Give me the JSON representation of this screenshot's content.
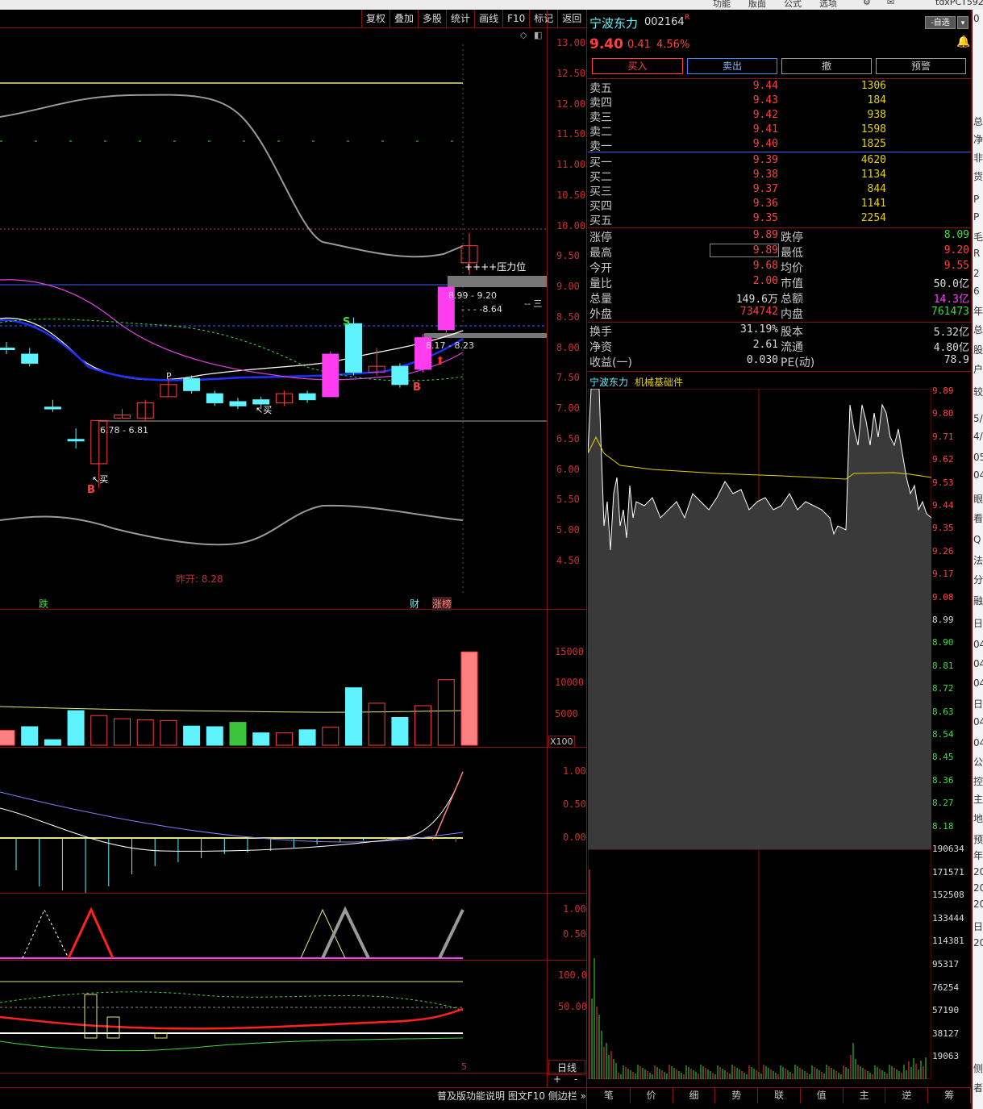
{
  "topbar": {
    "items": [
      "功能",
      "版面",
      "公式",
      "选项"
    ],
    "window_title": "tdxPCT592"
  },
  "toolbar": {
    "buttons": [
      "复权",
      "叠加",
      "多股",
      "统计",
      "画线",
      "F10",
      "标记",
      "返回"
    ]
  },
  "kline": {
    "y_axis": [
      "13.00",
      "12.50",
      "12.00",
      "11.50",
      "11.00",
      "10.50",
      "10.00",
      "9.50",
      "9.00",
      "8.50",
      "8.00",
      "7.50",
      "7.00",
      "6.50",
      "6.00",
      "5.50",
      "5.00",
      "4.50"
    ],
    "annotations": {
      "pressure": "++++压力位",
      "range_high": "8.99 - 9.20",
      "level_864": "- - - -8.64",
      "range_mid": "8.17 - 8.23",
      "range_low": "6.78 - 6.81",
      "buy1": "买",
      "buy2": "买",
      "b1": "B",
      "b2": "B",
      "s": "S",
      "p": "P",
      "dash_text": "-- 三",
      "prev_open": "昨开: 8.28",
      "die": "跌",
      "cai": "财",
      "zhangbang": "涨榜"
    },
    "candles": [
      {
        "o": 8.0,
        "c": 8.0,
        "h": 8.1,
        "l": 7.9
      },
      {
        "o": 7.9,
        "c": 7.75,
        "h": 8.0,
        "l": 7.7
      },
      {
        "o": 7.03,
        "c": 7.0,
        "h": 7.15,
        "l": 6.95
      },
      {
        "o": 6.5,
        "c": 6.5,
        "h": 6.68,
        "l": 6.35
      },
      {
        "o": 6.1,
        "c": 6.81,
        "h": 6.81,
        "l": 5.7
      },
      {
        "o": 6.85,
        "c": 6.9,
        "h": 7.0,
        "l": 6.85
      },
      {
        "o": 6.85,
        "c": 7.1,
        "h": 7.15,
        "l": 6.8
      },
      {
        "o": 7.2,
        "c": 7.4,
        "h": 7.5,
        "l": 7.2
      },
      {
        "o": 7.5,
        "c": 7.3,
        "h": 7.55,
        "l": 7.25
      },
      {
        "o": 7.25,
        "c": 7.1,
        "h": 7.3,
        "l": 7.05
      },
      {
        "o": 7.05,
        "c": 7.12,
        "h": 7.18,
        "l": 7.0
      },
      {
        "o": 7.15,
        "c": 7.08,
        "h": 7.2,
        "l": 7.0
      },
      {
        "o": 7.1,
        "c": 7.25,
        "h": 7.3,
        "l": 7.05
      },
      {
        "o": 7.25,
        "c": 7.15,
        "h": 7.3,
        "l": 7.1
      },
      {
        "o": 7.2,
        "c": 7.9,
        "h": 7.95,
        "l": 7.2
      },
      {
        "o": 8.4,
        "c": 7.6,
        "h": 8.5,
        "l": 7.55
      },
      {
        "o": 7.6,
        "c": 7.7,
        "h": 8.0,
        "l": 7.55
      },
      {
        "o": 7.7,
        "c": 7.4,
        "h": 7.75,
        "l": 7.35
      },
      {
        "o": 7.65,
        "c": 8.17,
        "h": 8.23,
        "l": 7.6
      },
      {
        "o": 8.3,
        "c": 9.0,
        "h": 9.0,
        "l": 8.25
      },
      {
        "o": 9.68,
        "c": 9.4,
        "h": 9.89,
        "l": 9.2
      }
    ]
  },
  "volume": {
    "y_axis": [
      "15000",
      "10000",
      "5000"
    ],
    "unit": "X100",
    "bars": [
      2400,
      3000,
      900,
      5600,
      4800,
      4300,
      4100,
      4000,
      3100,
      3000,
      3700,
      2000,
      2000,
      2500,
      2900,
      9300,
      6800,
      4500,
      6400,
      10600,
      15100
    ],
    "colors": [
      "red",
      "cyan",
      "cyan",
      "cyan",
      "red",
      "red",
      "red",
      "red",
      "cyan",
      "cyan",
      "green",
      "cyan",
      "red",
      "cyan",
      "red",
      "cyan",
      "red",
      "cyan",
      "red",
      "red",
      "red"
    ]
  },
  "macd": {
    "y_axis": [
      "1.00",
      "0.50",
      "0.00"
    ]
  },
  "kdj": {
    "y_axis": [
      "1.00",
      "0.50"
    ]
  },
  "rsi": {
    "y_axis": [
      "100.0",
      "50.00"
    ]
  },
  "bottom": {
    "cycle": "日线",
    "plus": "+",
    "minus": "-",
    "left_label": "5",
    "status_text": "普及版功能说明 图文F10 侧边栏 »"
  },
  "quote": {
    "name": "宁波东力",
    "code": "002164",
    "flag": "R",
    "watch": "-自选",
    "price": "9.40",
    "change": "0.41",
    "pct": "4.56%",
    "buttons": [
      "买入",
      "卖出",
      "撤",
      "预警"
    ],
    "asks": [
      {
        "label": "卖五",
        "price": "9.44",
        "vol": "1306"
      },
      {
        "label": "卖四",
        "price": "9.43",
        "vol": "184"
      },
      {
        "label": "卖三",
        "price": "9.42",
        "vol": "938"
      },
      {
        "label": "卖二",
        "price": "9.41",
        "vol": "1598"
      },
      {
        "label": "卖一",
        "price": "9.40",
        "vol": "1825"
      }
    ],
    "bids": [
      {
        "label": "买一",
        "price": "9.39",
        "vol": "4620"
      },
      {
        "label": "买二",
        "price": "9.38",
        "vol": "1134"
      },
      {
        "label": "买三",
        "price": "9.37",
        "vol": "844"
      },
      {
        "label": "买四",
        "price": "9.36",
        "vol": "1141"
      },
      {
        "label": "买五",
        "price": "9.35",
        "vol": "2254"
      }
    ],
    "stats": [
      {
        "l1": "涨停",
        "v1": "9.89",
        "l2": "跌停",
        "v2": "8.09",
        "c1": "#ff4040",
        "c2": "#3cdc3c"
      },
      {
        "l1": "最高",
        "v1": "9.89",
        "l2": "最低",
        "v2": "9.20",
        "c1": "#ff4040",
        "c2": "#ff4040"
      },
      {
        "l1": "今开",
        "v1": "9.68",
        "l2": "均价",
        "v2": "9.55",
        "c1": "#ff4040",
        "c2": "#ff4040"
      },
      {
        "l1": "量比",
        "v1": "2.00",
        "l2": "市值",
        "v2": "50.0亿",
        "c1": "#ff4040",
        "c2": "#dcdcdc"
      },
      {
        "l1": "总量",
        "v1": "149.6万",
        "l2": "总额",
        "v2": "14.3亿",
        "c1": "#dcdcdc",
        "c2": "#ff40ff"
      },
      {
        "l1": "外盘",
        "v1": "734742",
        "l2": "内盘",
        "v2": "761473",
        "c1": "#ff4040",
        "c2": "#3cdc3c"
      }
    ],
    "stats2": [
      {
        "l1": "换手",
        "v1": "31.19%",
        "l2": "股本",
        "v2": "5.32亿"
      },
      {
        "l1": "净资",
        "v1": "2.61",
        "l2": "流通",
        "v2": "4.80亿"
      },
      {
        "l1": "收益(一)",
        "v1": "0.030",
        "l2": "PE(动)",
        "v2": "78.9"
      }
    ]
  },
  "intraday": {
    "title": "宁波东力",
    "sector": "机械基础件",
    "price_axis": [
      "9.89",
      "9.80",
      "9.71",
      "9.62",
      "9.53",
      "9.44",
      "9.35",
      "9.26",
      "9.17",
      "9.08",
      "8.99",
      "8.90",
      "8.81",
      "8.72",
      "8.63",
      "8.54",
      "8.45",
      "8.36",
      "8.27",
      "8.18"
    ],
    "vol_axis": [
      "190634",
      "171571",
      "152508",
      "133444",
      "114381",
      "95317",
      "76254",
      "57190",
      "38127",
      "19063"
    ],
    "tabs": [
      "笔",
      "价",
      "细",
      "势",
      "联",
      "值",
      "主",
      "逆",
      "筹"
    ]
  },
  "right_strip": [
    "0",
    "总",
    "净",
    "非",
    "货",
    "P",
    "P",
    "毛",
    "R",
    "2",
    "6",
    "年",
    "总",
    "股",
    "户",
    "较",
    "5/",
    "4/",
    "05",
    "04",
    "眼",
    "看",
    "Q",
    "法",
    "分",
    "融",
    "日",
    "04",
    "04",
    "04",
    "日",
    "04",
    "04",
    "公",
    "控",
    "主",
    "地",
    "预",
    "年",
    "20",
    "20",
    "20",
    "日",
    "20",
    "侧",
    "者"
  ],
  "colors": {
    "up": "#ff4040",
    "down": "#3cdc3c",
    "cyan": "#5ff3ff",
    "magenta": "#ff3cf0",
    "yellow": "#e6d200",
    "border": "#8a1010"
  }
}
